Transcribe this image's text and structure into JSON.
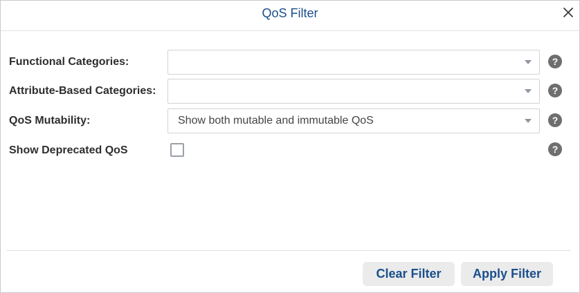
{
  "dialog": {
    "title": "QoS Filter"
  },
  "fields": {
    "functional_categories": {
      "label": "Functional Categories:",
      "value": ""
    },
    "attribute_categories": {
      "label": "Attribute-Based Categories:",
      "value": ""
    },
    "qos_mutability": {
      "label": "QoS Mutability:",
      "value": "Show both mutable and immutable QoS"
    },
    "show_deprecated": {
      "label": "Show Deprecated QoS",
      "checked": false
    }
  },
  "help_glyph": "?",
  "buttons": {
    "clear": "Clear Filter",
    "apply": "Apply Filter"
  },
  "icons": {
    "close": "close-icon",
    "dropdown": "chevron-down-icon",
    "help": "help-icon"
  },
  "colors": {
    "title": "#1a4f8b",
    "button_text": "#1a4f8b",
    "button_bg": "#ebebeb",
    "help_bg": "#6e6e6e"
  }
}
